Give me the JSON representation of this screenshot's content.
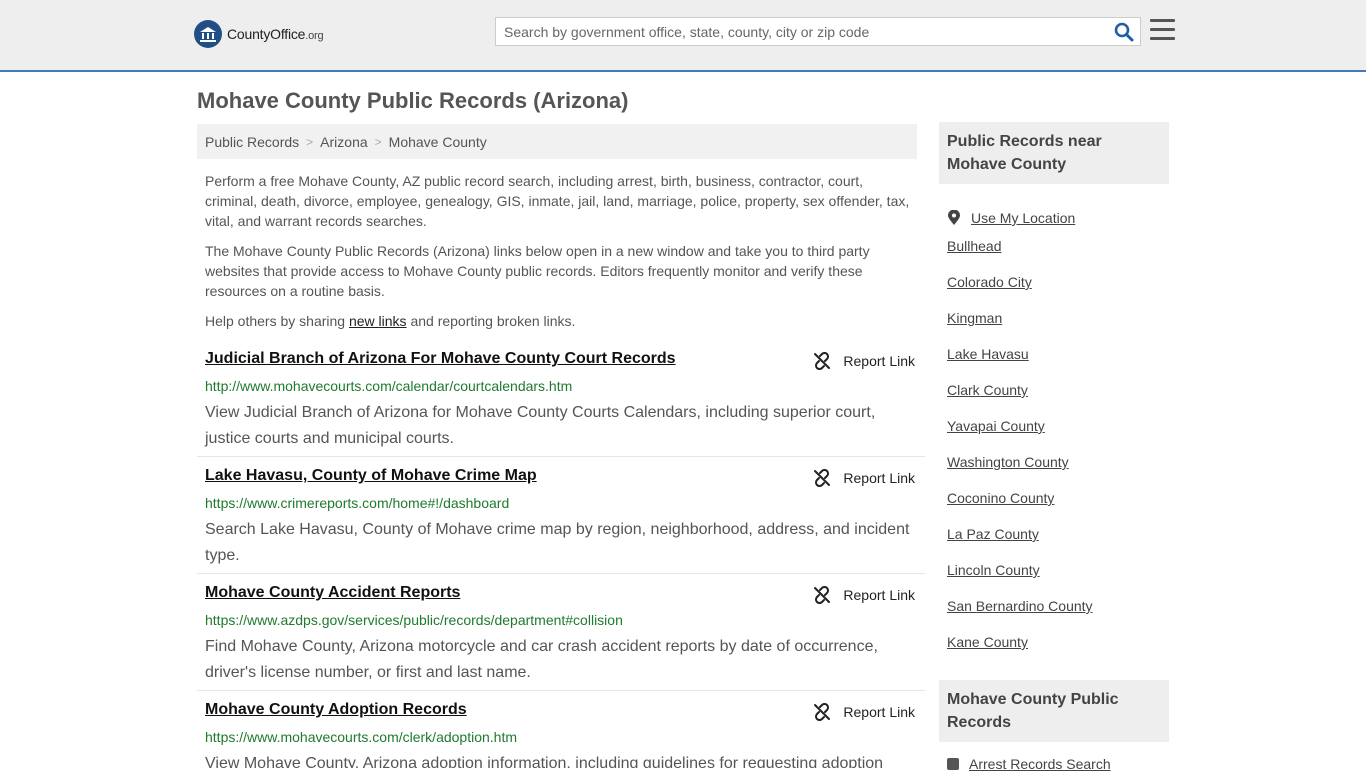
{
  "header": {
    "logo_main": "CountyOffice",
    "logo_org": ".org",
    "search_placeholder": "Search by government office, state, county, city or zip code"
  },
  "page_title": "Mohave County Public Records (Arizona)",
  "breadcrumb": [
    "Public Records",
    "Arizona",
    "Mohave County"
  ],
  "intro": {
    "p1": "Perform a free Mohave County, AZ public record search, including arrest, birth, business, contractor, court, criminal, death, divorce, employee, genealogy, GIS, inmate, jail, land, marriage, police, property, sex offender, tax, vital, and warrant records searches.",
    "p2": "The Mohave County Public Records (Arizona) links below open in a new window and take you to third party websites that provide access to Mohave County public records. Editors frequently monitor and verify these resources on a routine basis.",
    "p3_before": "Help others by sharing ",
    "p3_link": "new links",
    "p3_after": " and reporting broken links."
  },
  "report_label": "Report Link",
  "records": [
    {
      "title": "Judicial Branch of Arizona For Mohave County Court Records",
      "url": "http://www.mohavecourts.com/calendar/courtcalendars.htm",
      "desc": "View Judicial Branch of Arizona for Mohave County Courts Calendars, including superior court, justice courts and municipal courts."
    },
    {
      "title": "Lake Havasu, County of Mohave Crime Map",
      "url": "https://www.crimereports.com/home#!/dashboard",
      "desc": "Search Lake Havasu, County of Mohave crime map by region, neighborhood, address, and incident type."
    },
    {
      "title": "Mohave County Accident Reports",
      "url": "https://www.azdps.gov/services/public/records/department#collision",
      "desc": "Find Mohave County, Arizona motorcycle and car crash accident reports by date of occurrence, driver's license number, or first and last name."
    },
    {
      "title": "Mohave County Adoption Records",
      "url": "https://www.mohavecourts.com/clerk/adoption.htm",
      "desc": "View Mohave County, Arizona adoption information, including guidelines for requesting adoption"
    }
  ],
  "sidebar": {
    "heading1": "Public Records near Mohave County",
    "use_location": "Use My Location",
    "nearby": [
      "Bullhead",
      "Colorado City",
      "Kingman",
      "Lake Havasu",
      "Clark County",
      "Yavapai County",
      "Washington County",
      "Coconino County",
      "La Paz County",
      "Lincoln County",
      "San Bernardino County",
      "Kane County"
    ],
    "heading2": "Mohave County Public Records",
    "bottom_item": "Arrest Records Search"
  },
  "colors": {
    "accent_border": "#3f7bbf",
    "url_green": "#1f7a2e",
    "logo_blue": "#1f4f86"
  }
}
